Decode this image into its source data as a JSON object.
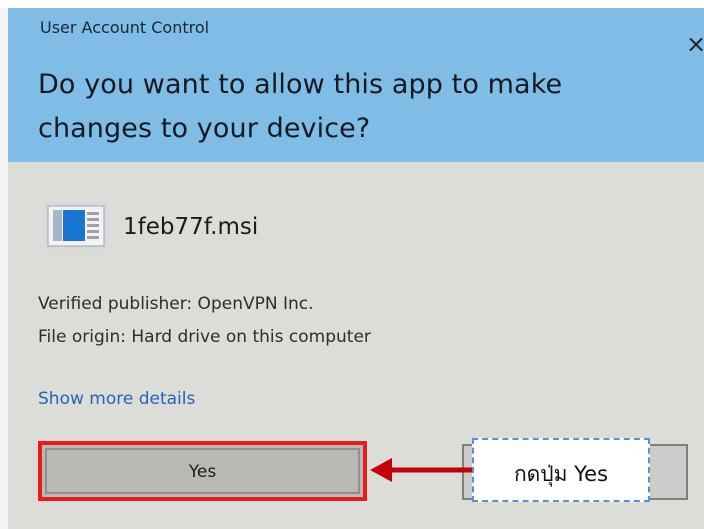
{
  "dialog": {
    "window_title": "User Account Control",
    "question_line_1": "Do you want to allow this app to make",
    "question_line_2": "changes to your device?",
    "close_symbol": "×",
    "file_name": "1feb77f.msi",
    "publisher": "Verified publisher: OpenVPN Inc.",
    "origin": "File origin: Hard drive on this computer",
    "details_link": "Show more details",
    "yes_label": "Yes"
  },
  "annotation": {
    "label": "กดปุ่ม Yes"
  },
  "colors": {
    "header": "#80bde6",
    "body": "#dcdcda",
    "highlight": "#ea1b1b",
    "link": "#1f66b9",
    "annotation_border": "#5b8fd0"
  },
  "icons": {
    "close": "close-icon",
    "installer": "msi-file-icon",
    "arrow": "pointer-arrow-icon"
  }
}
